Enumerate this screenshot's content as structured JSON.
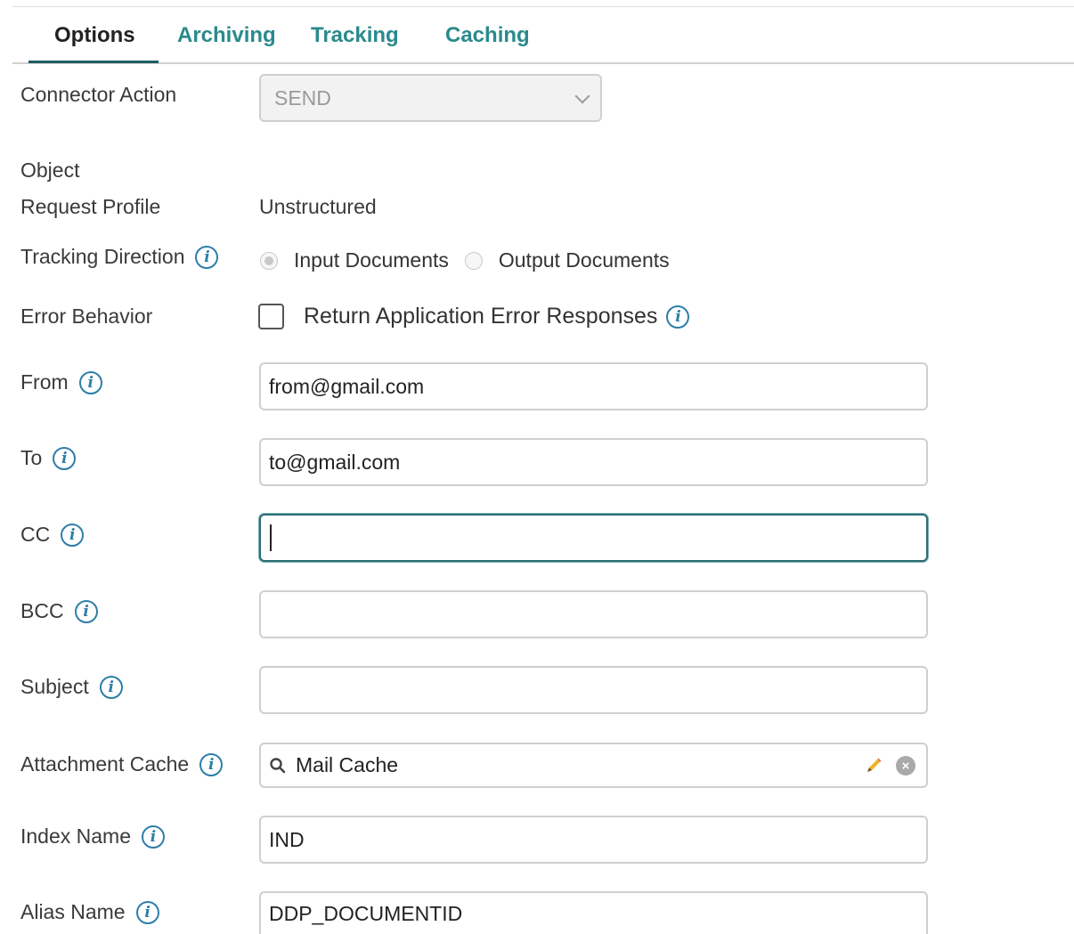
{
  "tabs": [
    {
      "label": "Options",
      "active": true
    },
    {
      "label": "Archiving",
      "active": false
    },
    {
      "label": "Tracking",
      "active": false
    },
    {
      "label": "Caching",
      "active": false
    }
  ],
  "connector_action": {
    "label": "Connector Action",
    "value": "SEND"
  },
  "object": {
    "label": "Object"
  },
  "request_profile": {
    "label": "Request Profile",
    "value": "Unstructured"
  },
  "tracking_direction": {
    "label": "Tracking Direction",
    "options": [
      "Input Documents",
      "Output Documents"
    ],
    "selected": "Input Documents"
  },
  "error_behavior": {
    "label": "Error Behavior",
    "checkbox_label": "Return Application Error Responses",
    "checked": false
  },
  "fields": {
    "from": {
      "label": "From",
      "value": "from@gmail.com"
    },
    "to": {
      "label": "To",
      "value": "to@gmail.com"
    },
    "cc": {
      "label": "CC",
      "value": ""
    },
    "bcc": {
      "label": "BCC",
      "value": ""
    },
    "subject": {
      "label": "Subject",
      "value": ""
    },
    "attachment_cache": {
      "label": "Attachment Cache",
      "value": "Mail Cache"
    },
    "index_name": {
      "label": "Index Name",
      "value": "IND"
    },
    "alias_name": {
      "label": "Alias Name",
      "value": "DDP_DOCUMENTID"
    }
  },
  "icons": {
    "info": "info-icon",
    "search": "search-icon",
    "edit": "pencil-icon",
    "clear": "clear-icon",
    "chevron": "chevron-down-icon"
  },
  "colors": {
    "accent": "#2a8a8c",
    "info": "#2e7ea8",
    "focus": "#2b6e73"
  }
}
